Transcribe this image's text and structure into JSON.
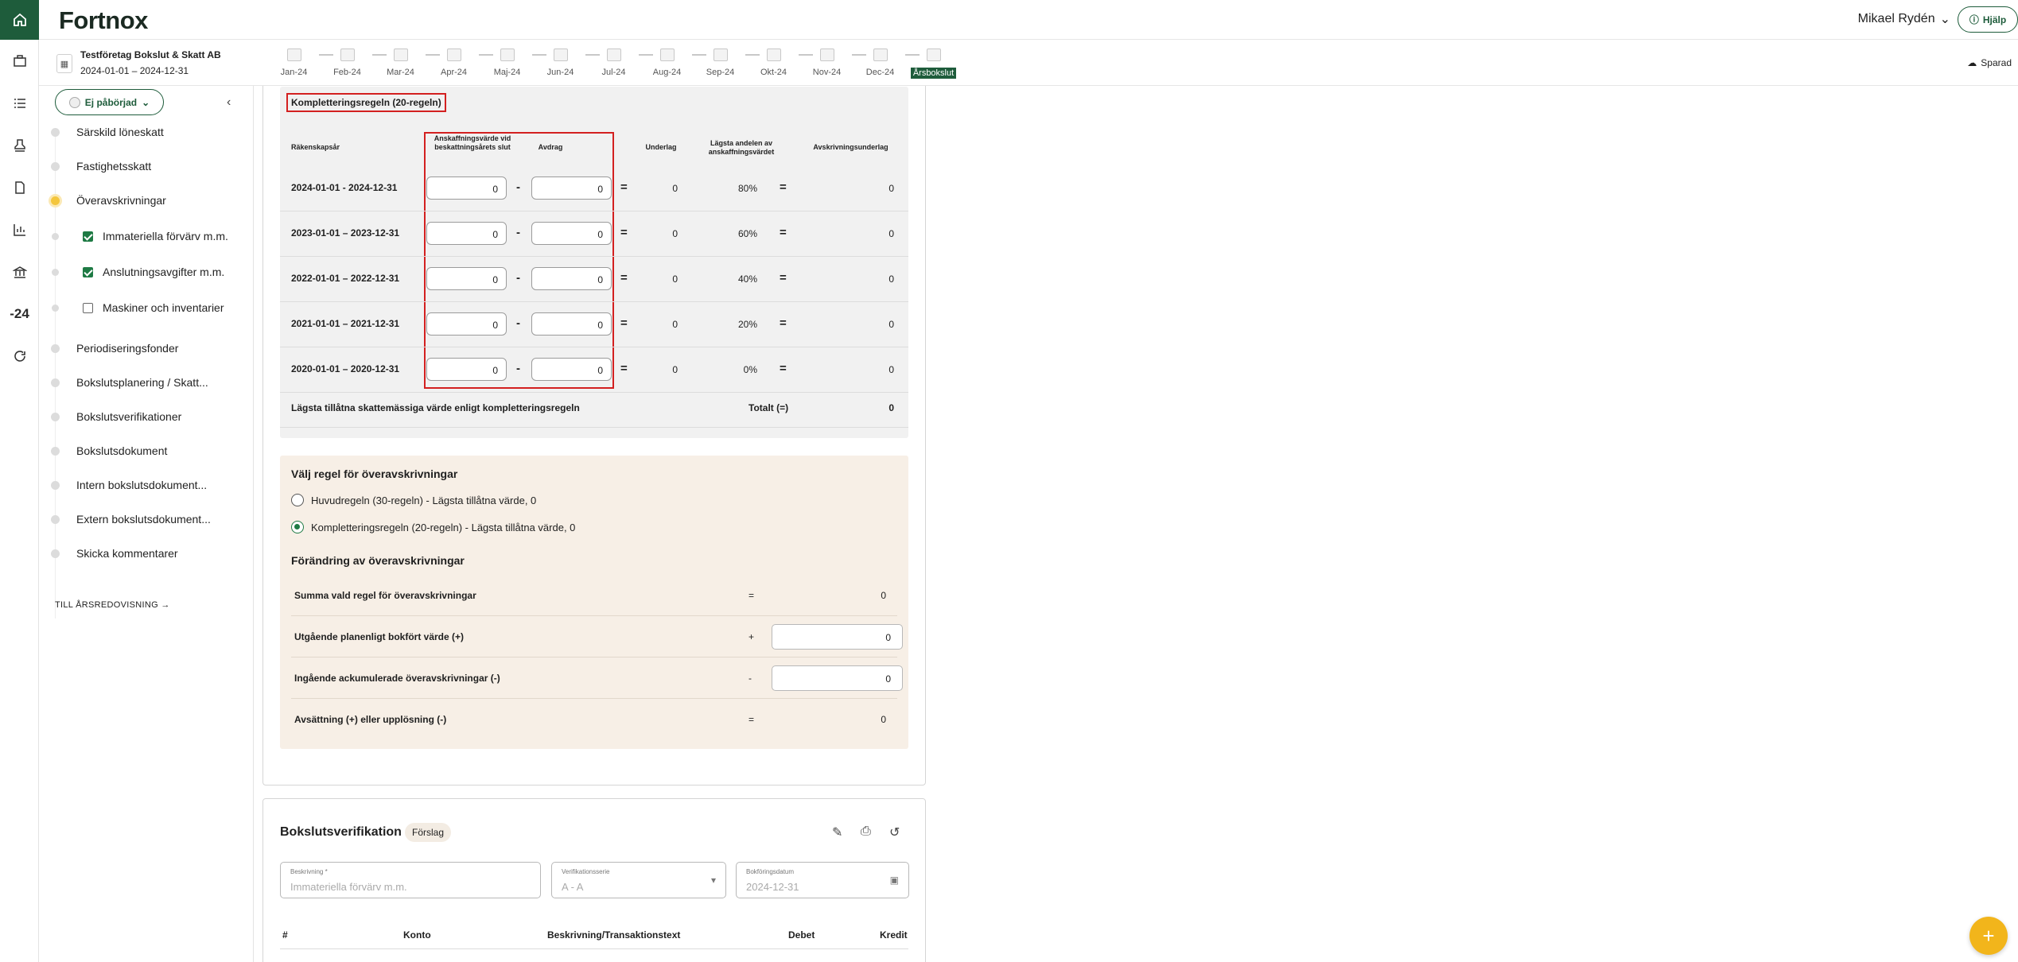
{
  "app": {
    "logo": "Fortnox",
    "user": "Mikael Rydén",
    "help_label": "Hjälp",
    "saved_label": "Sparad",
    "rail_year": "-24"
  },
  "company": {
    "name": "Testföretag Bokslut & Skatt AB",
    "period": "2024-01-01 – 2024-12-31"
  },
  "months": [
    "Jan-24",
    "Feb-24",
    "Mar-24",
    "Apr-24",
    "Maj-24",
    "Jun-24",
    "Jul-24",
    "Aug-24",
    "Sep-24",
    "Okt-24",
    "Nov-24",
    "Dec-24",
    "Årsbokslut"
  ],
  "sidebar": {
    "status": "Ej påbörjad",
    "items": [
      {
        "label": "Särskild löneskatt"
      },
      {
        "label": "Fastighetsskatt"
      },
      {
        "label": "Överavskrivningar"
      },
      {
        "label": "Immateriella förvärv m.m."
      },
      {
        "label": "Anslutningsavgifter m.m."
      },
      {
        "label": "Maskiner och inventarier"
      },
      {
        "label": "Periodiseringsfonder"
      },
      {
        "label": "Bokslutsplanering / Skatt..."
      },
      {
        "label": "Bokslutsverifikationer"
      },
      {
        "label": "Bokslutsdokument"
      },
      {
        "label": "Intern bokslutsdokument..."
      },
      {
        "label": "Extern bokslutsdokument..."
      },
      {
        "label": "Skicka kommentarer"
      }
    ],
    "link": "TILL ÅRSREDOVISNING"
  },
  "komp": {
    "title": "Kompletteringsregeln (20-regeln)",
    "headers": {
      "year": "Räkenskapsår",
      "acq": "Anskaffningsvärde vid beskattningsårets slut",
      "ded": "Avdrag",
      "base": "Underlag",
      "share": "Lägsta andelen av anskaffningsvärdet",
      "dep": "Avskrivningsunderlag"
    },
    "rows": [
      {
        "year": "2024-01-01 - 2024-12-31",
        "acq": "0",
        "ded": "0",
        "base": "0",
        "pct": "80%",
        "dep": "0"
      },
      {
        "year": "2023-01-01 – 2023-12-31",
        "acq": "0",
        "ded": "0",
        "base": "0",
        "pct": "60%",
        "dep": "0"
      },
      {
        "year": "2022-01-01 – 2022-12-31",
        "acq": "0",
        "ded": "0",
        "base": "0",
        "pct": "40%",
        "dep": "0"
      },
      {
        "year": "2021-01-01 – 2021-12-31",
        "acq": "0",
        "ded": "0",
        "base": "0",
        "pct": "20%",
        "dep": "0"
      },
      {
        "year": "2020-01-01 – 2020-12-31",
        "acq": "0",
        "ded": "0",
        "base": "0",
        "pct": "0%",
        "dep": "0"
      }
    ],
    "minus": "-",
    "equals": "=",
    "sum_label": "Lägsta tillåtna skattemässiga värde enligt kompletteringsregeln",
    "total_label": "Totalt (=)",
    "total_value": "0"
  },
  "rule": {
    "title": "Välj regel för överavskrivningar",
    "opt1": "Huvudregeln (30-regeln) - Lägsta tillåtna värde, 0",
    "opt2": "Kompletteringsregeln (20-regeln) - Lägsta tillåtna värde, 0",
    "change_title": "Förändring av överavskrivningar",
    "rows": [
      {
        "label": "Summa vald regel för överavskrivningar",
        "op": "=",
        "value": "0"
      },
      {
        "label": "Utgående planenligt bokfört värde (+)",
        "op": "+",
        "value": "0"
      },
      {
        "label": "Ingående ackumulerade överavskrivningar (-)",
        "op": "-",
        "value": "0"
      },
      {
        "label": "Avsättning (+) eller upplösning (-)",
        "op": "=",
        "value": "0"
      }
    ]
  },
  "verif": {
    "title": "Bokslutsverifikation",
    "badge": "Förslag",
    "desc_label": "Beskrivning *",
    "desc_placeholder": "Immateriella förvärv m.m.",
    "series_label": "Verifikationsserie",
    "series_value": "A - A",
    "date_label": "Bokföringsdatum",
    "date_placeholder": "2024-12-31",
    "cols": [
      "#",
      "Konto",
      "Beskrivning/Transaktionstext",
      "Debet",
      "Kredit"
    ]
  }
}
